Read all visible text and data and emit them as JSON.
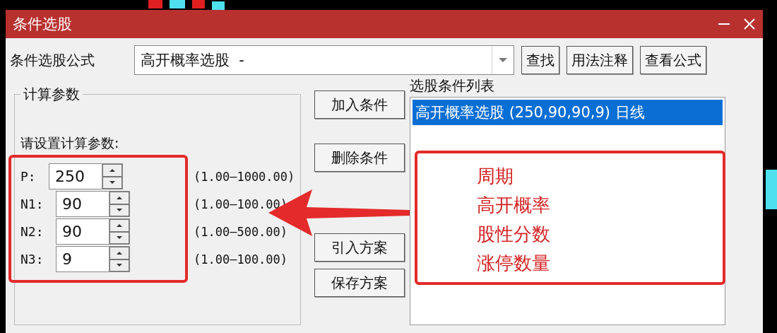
{
  "window": {
    "title": "条件选股"
  },
  "formula": {
    "label": "条件选股公式",
    "value": "高开概率选股  -"
  },
  "formula_buttons": [
    "查找",
    "用法注释",
    "查看公式"
  ],
  "params": {
    "title": "计算参数",
    "prompt": "请设置计算参数:",
    "rows": [
      {
        "name": "P:",
        "value": "250",
        "range": "(1.00—1000.00)"
      },
      {
        "name": "N1:",
        "value": "90",
        "range": "(1.00—100.00)"
      },
      {
        "name": "N2:",
        "value": "90",
        "range": "(1.00—500.00)"
      },
      {
        "name": "N3:",
        "value": "9",
        "range": "(1.00—100.00)"
      }
    ]
  },
  "actions": [
    "加入条件",
    "删除条件",
    "引入方案",
    "保存方案"
  ],
  "condition_list": {
    "title": "选股条件列表",
    "items": [
      {
        "text": "高开概率选股 (250,90,90,9) 日线",
        "selected": true
      }
    ]
  },
  "annotation": {
    "lines": [
      "周期",
      "高开概率",
      "股性分数",
      "涨停数量"
    ]
  }
}
